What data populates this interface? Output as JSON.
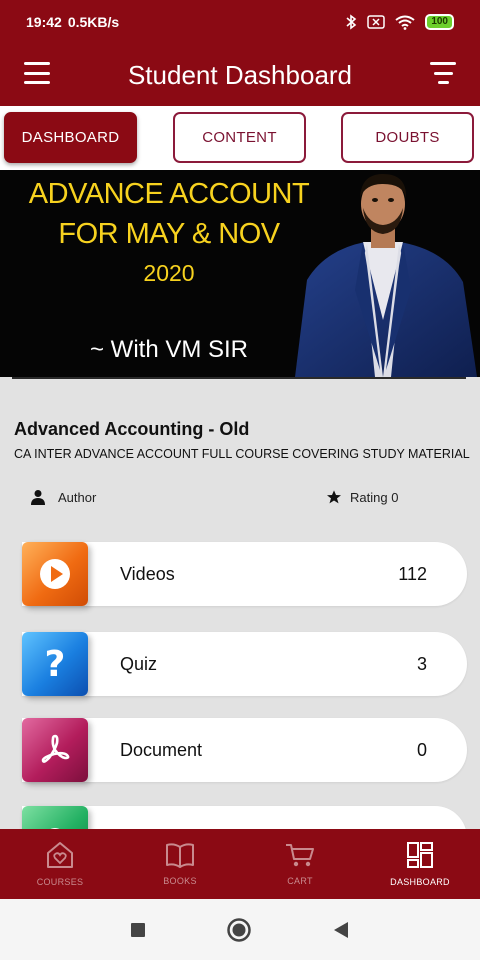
{
  "status_bar": {
    "time": "19:42",
    "speed": "0.5KB/s",
    "battery": "100"
  },
  "app_bar": {
    "title": "Student Dashboard"
  },
  "tabs": [
    {
      "label": "DASHBOARD",
      "active": true
    },
    {
      "label": "CONTENT",
      "active": false
    },
    {
      "label": "DOUBTS",
      "active": false
    }
  ],
  "banner": {
    "line1": "ADVANCE ACCOUNT",
    "line2": "FOR MAY & NOV",
    "line3": "2020",
    "line4": "~ With VM SIR"
  },
  "course": {
    "title": "Advanced Accounting - Old",
    "subtitle": "CA INTER ADVANCE ACCOUNT FULL COURSE COVERING STUDY MATERIAL",
    "author_label": "Author",
    "rating_label": "Rating 0"
  },
  "stats": [
    {
      "label": "Videos",
      "value": "112",
      "icon": "video-play-icon"
    },
    {
      "label": "Quiz",
      "value": "3",
      "icon": "quiz-question-icon"
    },
    {
      "label": "Document",
      "value": "0",
      "icon": "pdf-document-icon"
    }
  ],
  "bottom_nav": [
    {
      "label": "COURSES",
      "icon": "heart-home-icon",
      "active": false
    },
    {
      "label": "BOOKS",
      "icon": "book-icon",
      "active": false
    },
    {
      "label": "CART",
      "icon": "cart-icon",
      "active": false
    },
    {
      "label": "DASHBOARD",
      "icon": "dashboard-icon",
      "active": true
    }
  ],
  "colors": {
    "brand": "#8b0a14",
    "banner_yellow": "#f7d21f"
  }
}
